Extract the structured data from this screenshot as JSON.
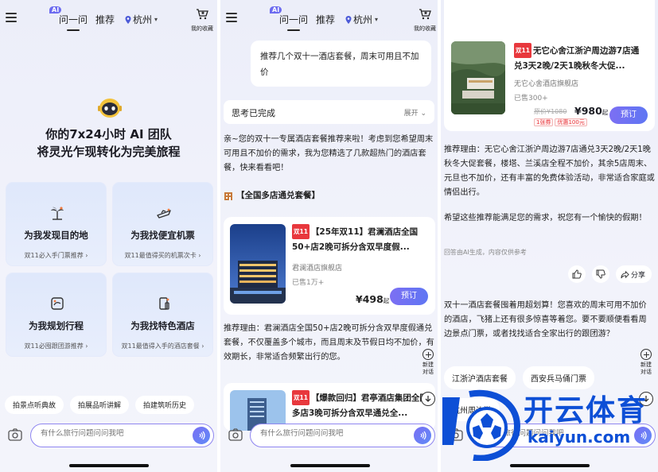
{
  "header": {
    "ai_badge": "AI",
    "tab_wenwen": "问一问",
    "tab_recommend": "推荐",
    "city": "杭州",
    "favorites": "我的收藏"
  },
  "screen1": {
    "hero_line1": "你的7x24小时 AI 团队",
    "hero_line2": "将灵光乍现转化为完美旅程",
    "features": [
      {
        "title": "为我发现目的地",
        "sub": "双11必入手门票推荐 ›",
        "icon": "palm-island-icon"
      },
      {
        "title": "为我找便宜机票",
        "sub": "双11最值得买的机票次卡 ›",
        "icon": "airplane-icon"
      },
      {
        "title": "为我规划行程",
        "sub": "双11必囤跟团游推荐 ›",
        "icon": "itinerary-icon"
      },
      {
        "title": "为我找特色酒店",
        "sub": "双11最值得入手的酒店套餐 ›",
        "icon": "hotel-icon"
      }
    ],
    "chips": [
      "拍景点听典故",
      "拍展品听讲解",
      "拍建筑听历史"
    ],
    "input_placeholder": "有什么旅行问题问问我吧"
  },
  "screen2": {
    "user_message": "推荐几个双十一酒店套餐，周末可用且不加价",
    "thinking_done": "思考已完成",
    "expand": "展开",
    "intro": "亲~您的双十一专属酒店套餐推荐来啦！考虑到您希望周末可用且不加价的需求，我为您精选了几款超热门的酒店套餐，快来看看吧！",
    "section_title": "【全国多店通兑套餐】",
    "card1": {
      "tag": "双11",
      "title": "【25年双11】君澜酒店全国50+店2晚可拆分含双早度假...",
      "shop": "君澜酒店旗舰店",
      "sold": "已售1万+",
      "price": "¥498",
      "price_suffix": "起",
      "book": "预订"
    },
    "reason": "推荐理由：君澜酒店全国50+店2晚可拆分含双早度假通兑套餐，不仅覆盖多个城市，而且周末及节假日均不加价，有效期长，非常适合频繁出行的您。",
    "card2": {
      "tag": "双11",
      "title": "【爆款回归】君亭酒店集团全国多店3晚可拆分含双早通兑全..."
    },
    "new_chat": "新建\n对话",
    "input_placeholder": "有什么旅行问题问问我吧"
  },
  "screen3": {
    "card": {
      "tag": "双11",
      "title": "无它心舍江浙沪周边游7店通兑3天2晚/2天1晚秋冬大促...",
      "shop": "无它心舍酒店旗舰店",
      "sold": "已售300+",
      "old_price": "原价¥1080",
      "price": "¥980",
      "price_suffix": "起",
      "coupon1": "1张券",
      "coupon2": "优惠100元",
      "book": "预订"
    },
    "reason": "推荐理由：无它心舍江浙沪周边游7店通兑3天2晚/2天1晚秋冬大促套餐，楼塔、兰溪店全程不加价，其余5店周末、元旦也不加价，还有丰富的免费体验活动，非常适合家庭或情侣出行。",
    "wish": "希望这些推荐能满足您的需求，祝您有一个愉快的假期！",
    "ai_generated": "回答由AI生成，内容仅供参考",
    "share": "分享",
    "followup": "双十一酒店套餐囤着用超划算！您喜欢的周末可用不加价的酒店，飞猪上还有很多惊喜等着您。要不要顺便看看周边景点门票，或者找找适合全家出行的跟团游？",
    "pills": [
      "江浙沪酒店套餐",
      "西安兵马俑门票"
    ],
    "partial_bubble": "杭州周边游",
    "new_chat": "新建\n对话",
    "input_placeholder": "有什么旅行问题问问我吧"
  },
  "watermark": {
    "text": "开云体育",
    "url": "kaiyun.com"
  }
}
